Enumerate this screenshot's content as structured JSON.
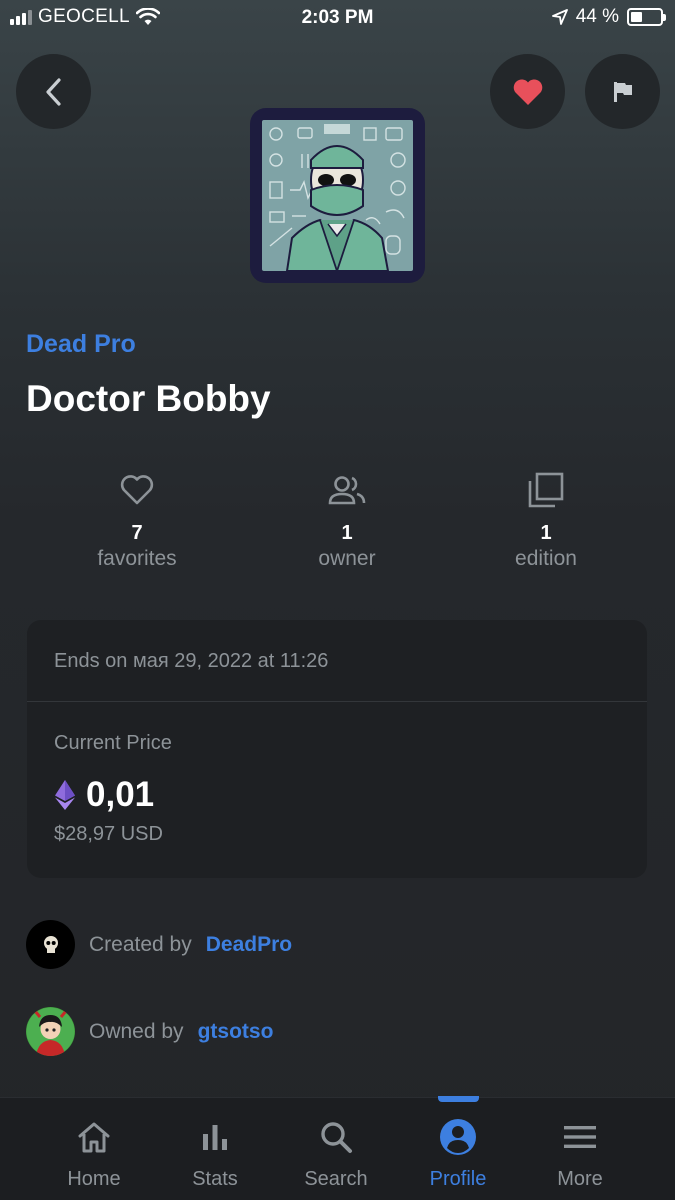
{
  "status_bar": {
    "carrier": "GEOCELL",
    "time": "2:03 PM",
    "battery": "44 %",
    "icons": [
      "signal-icon",
      "wifi-icon",
      "location-arrow-icon",
      "battery-icon"
    ]
  },
  "header": {
    "back_icon": "chevron-left-icon",
    "favorite_icon": "heart-icon",
    "report_icon": "flag-icon",
    "favorite_color": "#e8505b"
  },
  "item": {
    "collection": "Dead Pro",
    "title": "Doctor Bobby"
  },
  "stats": {
    "favorites": {
      "value": "7",
      "label": "favorites",
      "icon": "heart-outline-icon"
    },
    "owners": {
      "value": "1",
      "label": "owner",
      "icon": "people-icon"
    },
    "editions": {
      "value": "1",
      "label": "edition",
      "icon": "copies-icon"
    }
  },
  "sale": {
    "ends_label": "Ends on",
    "ends_date": "мая 29, 2022 at 11:26",
    "current_price_label": "Current Price",
    "currency_icon": "ethereum-icon",
    "price": "0,01",
    "price_usd": "$28,97 USD"
  },
  "people": {
    "created_by_label": "Created by",
    "creator": "DeadPro",
    "owned_by_label": "Owned by",
    "owner": "gtsotso"
  },
  "tab_bar": {
    "accent": "#3d7fe0",
    "tabs": [
      {
        "label": "Home",
        "icon": "home-icon"
      },
      {
        "label": "Stats",
        "icon": "stats-icon"
      },
      {
        "label": "Search",
        "icon": "search-icon"
      },
      {
        "label": "Profile",
        "icon": "profile-icon",
        "active": true
      },
      {
        "label": "More",
        "icon": "menu-icon"
      }
    ]
  }
}
